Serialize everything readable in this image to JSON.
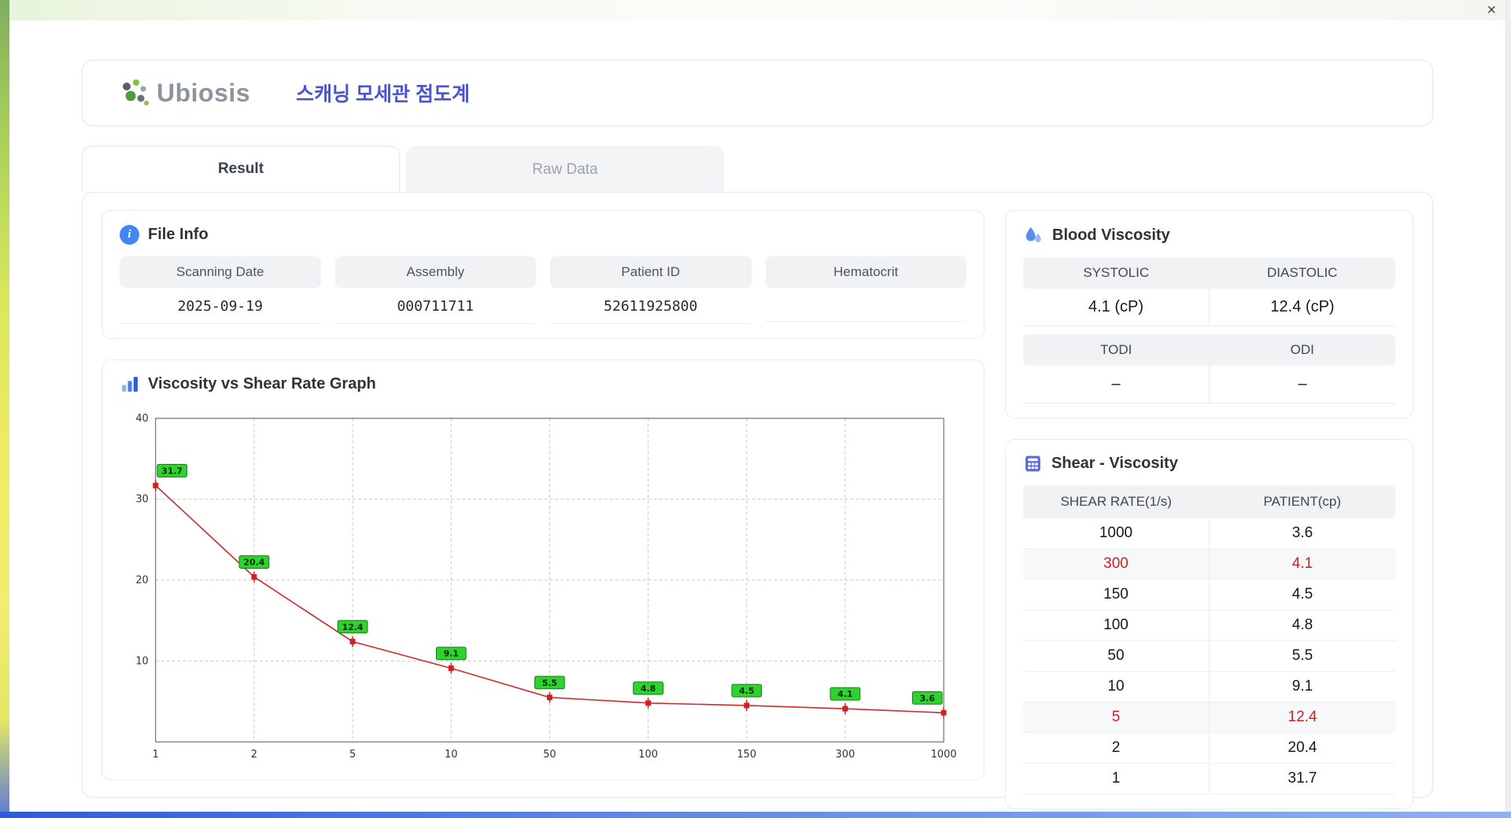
{
  "window": {
    "close_icon": "×"
  },
  "header": {
    "logo_text": "Ubiosis",
    "title": "스캐닝 모세관 점도계"
  },
  "tabs": [
    {
      "label": "Result",
      "active": true
    },
    {
      "label": "Raw Data",
      "active": false
    }
  ],
  "file_info": {
    "title": "File Info",
    "fields": [
      {
        "label": "Scanning Date",
        "value": "2025-09-19"
      },
      {
        "label": "Assembly",
        "value": "000711711"
      },
      {
        "label": "Patient ID",
        "value": "52611925800"
      },
      {
        "label": "Hematocrit",
        "value": ""
      }
    ]
  },
  "graph": {
    "title": "Viscosity vs Shear Rate Graph"
  },
  "blood_viscosity": {
    "title": "Blood Viscosity",
    "systolic_label": "SYSTOLIC",
    "systolic_value": "4.1 (cP)",
    "diastolic_label": "DIASTOLIC",
    "diastolic_value": "12.4 (cP)",
    "todi_label": "TODI",
    "todi_value": "–",
    "odi_label": "ODI",
    "odi_value": "–"
  },
  "shear_viscosity": {
    "title": "Shear - Viscosity",
    "columns": [
      "SHEAR RATE(1/s)",
      "PATIENT(cp)"
    ],
    "rows": [
      {
        "shear_rate": "1000",
        "patient": "3.6",
        "highlight": false
      },
      {
        "shear_rate": "300",
        "patient": "4.1",
        "highlight": true
      },
      {
        "shear_rate": "150",
        "patient": "4.5",
        "highlight": false
      },
      {
        "shear_rate": "100",
        "patient": "4.8",
        "highlight": false
      },
      {
        "shear_rate": "50",
        "patient": "5.5",
        "highlight": false
      },
      {
        "shear_rate": "10",
        "patient": "9.1",
        "highlight": false
      },
      {
        "shear_rate": "5",
        "patient": "12.4",
        "highlight": true
      },
      {
        "shear_rate": "2",
        "patient": "20.4",
        "highlight": false
      },
      {
        "shear_rate": "1",
        "patient": "31.7",
        "highlight": false
      }
    ]
  },
  "colors": {
    "accent_title": "#4a54d1",
    "highlight_red": "#cc2222",
    "point_label_green": "#2fd32f"
  },
  "chart_data": {
    "type": "line",
    "title": "Viscosity vs Shear Rate Graph",
    "x_categories": [
      "1",
      "2",
      "5",
      "10",
      "50",
      "100",
      "150",
      "300",
      "1000"
    ],
    "values": [
      31.7,
      20.4,
      12.4,
      9.1,
      5.5,
      4.8,
      4.5,
      4.1,
      3.6
    ],
    "point_labels": [
      "31.7",
      "20.4",
      "12.4",
      "9.1",
      "5.5",
      "4.8",
      "4.5",
      "4.1",
      "3.6"
    ],
    "xlabel": "",
    "ylabel": "",
    "ylim": [
      0,
      40
    ],
    "yticks": [
      10,
      20,
      30,
      40
    ],
    "grid": true,
    "x_scale": "categorical-log-ticks",
    "legend_position": "none",
    "line_color": "#cc2b2b",
    "marker_color": "#cc2222",
    "point_label_bg": "#2fd32f",
    "point_label_border": "#157a15"
  }
}
